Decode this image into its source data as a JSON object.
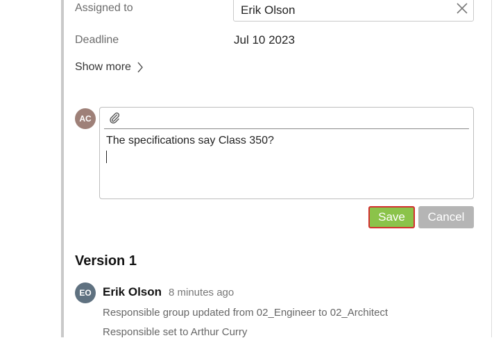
{
  "form": {
    "assigned_label": "Assigned to",
    "assigned_value": "Erik Olson",
    "deadline_label": "Deadline",
    "deadline_value": "Jul 10 2023",
    "show_more": "Show more"
  },
  "comment": {
    "avatar_initials": "AC",
    "avatar_color": "#9e8078",
    "text": "The specifications say Class 350?",
    "save_label": "Save",
    "cancel_label": "Cancel"
  },
  "version": {
    "title": "Version 1",
    "entry": {
      "avatar_initials": "EO",
      "avatar_color": "#5f7180",
      "author": "Erik Olson",
      "time": "8 minutes ago",
      "changes": [
        "Responsible group updated from 02_Engineer to 02_Architect",
        "Responsible set to Arthur Curry"
      ]
    }
  },
  "colors": {
    "save_bg": "#8bc34a",
    "save_border": "#d32f2f",
    "cancel_bg": "#b5b5b5",
    "panel_border": "#c9c9c9"
  }
}
